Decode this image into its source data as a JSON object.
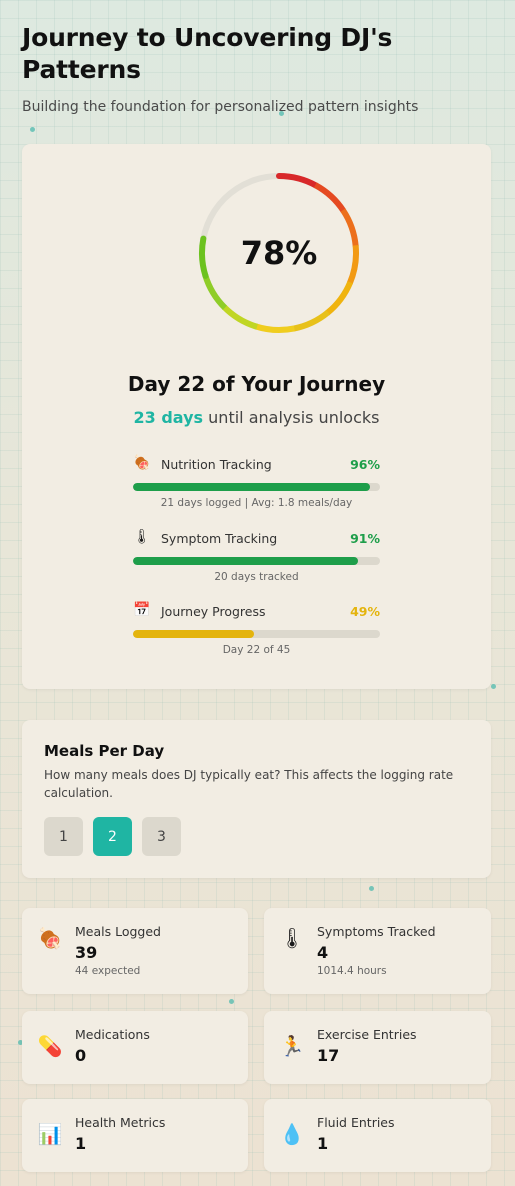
{
  "header": {
    "title": "Journey to Uncovering DJ's Patterns",
    "subtitle": "Building the foundation for personalized pattern insights"
  },
  "progress": {
    "percent": 78,
    "percent_label": "78%",
    "day_title": "Day 22 of Your Journey",
    "unlock_days": "23 days",
    "unlock_text": "until analysis unlocks",
    "metrics": [
      {
        "icon": "meat-icon",
        "glyph": "🍖",
        "label": "Nutrition Tracking",
        "pct": 96,
        "pct_label": "96%",
        "color": "#1e9e4a",
        "note": "21 days logged | Avg: 1.8 meals/day"
      },
      {
        "icon": "thermometer-icon",
        "glyph": "🌡",
        "label": "Symptom Tracking",
        "pct": 91,
        "pct_label": "91%",
        "color": "#1e9e4a",
        "note": "20 days tracked"
      },
      {
        "icon": "calendar-icon",
        "glyph": "📅",
        "label": "Journey Progress",
        "pct": 49,
        "pct_label": "49%",
        "color": "#e4b40d",
        "note": "Day 22 of 45"
      }
    ]
  },
  "meals": {
    "title": "Meals Per Day",
    "description": "How many meals does DJ typically eat? This affects the logging rate calculation.",
    "options": [
      "1",
      "2",
      "3"
    ],
    "selected": "2"
  },
  "stats": [
    {
      "icon": "meat-icon",
      "glyph": "🍖",
      "label": "Meals Logged",
      "value": "39",
      "sub": "44 expected"
    },
    {
      "icon": "thermometer-icon",
      "glyph": "🌡",
      "label": "Symptoms Tracked",
      "value": "4",
      "sub": "1014.4 hours"
    },
    {
      "icon": "pill-icon",
      "glyph": "💊",
      "label": "Medications",
      "value": "0",
      "sub": ""
    },
    {
      "icon": "runner-icon",
      "glyph": "🏃",
      "label": "Exercise Entries",
      "value": "17",
      "sub": ""
    },
    {
      "icon": "chart-icon",
      "glyph": "📊",
      "label": "Health Metrics",
      "value": "1",
      "sub": ""
    },
    {
      "icon": "droplet-icon",
      "glyph": "💧",
      "label": "Fluid Entries",
      "value": "1",
      "sub": ""
    }
  ],
  "colors": {
    "accent": "#1fb5a3",
    "good": "#1e9e4a",
    "warn": "#e4b40d",
    "ring_track": "#e2dfd6",
    "ring_segments": [
      "#d8282a",
      "#e54a22",
      "#ec6f1c",
      "#f29a14",
      "#f0b40f",
      "#e8c11a",
      "#f0cd1e",
      "#c0d624",
      "#8fcd28",
      "#6cc21f"
    ]
  }
}
